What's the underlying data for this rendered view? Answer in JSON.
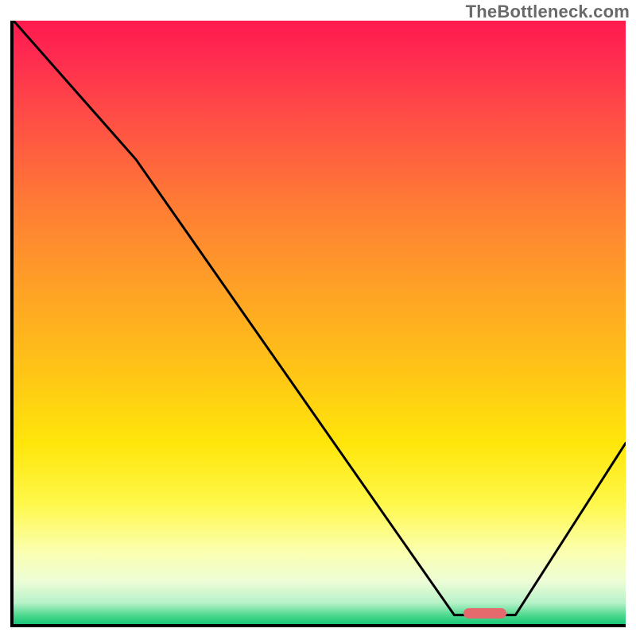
{
  "watermark": "TheBottleneck.com",
  "chart_data": {
    "type": "line",
    "title": "",
    "xlabel": "",
    "ylabel": "",
    "xlim": [
      0,
      100
    ],
    "ylim": [
      0,
      100
    ],
    "grid": false,
    "gradient_stops": [
      {
        "offset": 0,
        "color": "#ff1a4d"
      },
      {
        "offset": 0.05,
        "color": "#ff2850"
      },
      {
        "offset": 0.15,
        "color": "#ff4a47"
      },
      {
        "offset": 0.3,
        "color": "#ff7a35"
      },
      {
        "offset": 0.45,
        "color": "#ffa325"
      },
      {
        "offset": 0.58,
        "color": "#ffc416"
      },
      {
        "offset": 0.7,
        "color": "#ffe60a"
      },
      {
        "offset": 0.8,
        "color": "#fff84a"
      },
      {
        "offset": 0.88,
        "color": "#fbffaf"
      },
      {
        "offset": 0.93,
        "color": "#ecfdd7"
      },
      {
        "offset": 0.965,
        "color": "#b7f2c9"
      },
      {
        "offset": 0.985,
        "color": "#4fd98e"
      },
      {
        "offset": 1.0,
        "color": "#18c776"
      }
    ],
    "series": [
      {
        "name": "bottleneck-curve",
        "x": [
          0,
          20,
          72,
          78,
          82,
          100
        ],
        "y": [
          100,
          77,
          1.5,
          1.5,
          1.5,
          30
        ]
      }
    ],
    "marker": {
      "x_center": 77,
      "y_center": 1.8,
      "width_pct": 7.0,
      "height_pct": 1.8,
      "color": "#e56a6e"
    }
  }
}
